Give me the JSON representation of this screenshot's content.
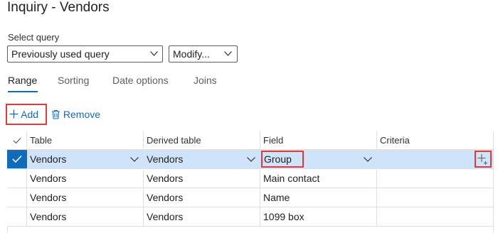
{
  "page": {
    "title": "Inquiry - Vendors"
  },
  "query": {
    "select_label": "Select query",
    "selected": "Previously used query",
    "modify_label": "Modify..."
  },
  "tabs": [
    {
      "label": "Range",
      "active": true
    },
    {
      "label": "Sorting",
      "active": false
    },
    {
      "label": "Date options",
      "active": false
    },
    {
      "label": "Joins",
      "active": false
    }
  ],
  "toolbar": {
    "add_label": "Add",
    "remove_label": "Remove"
  },
  "grid": {
    "headers": [
      "Table",
      "Derived table",
      "Field",
      "Criteria"
    ],
    "rows": [
      {
        "table": "Vendors",
        "derived": "Vendors",
        "field": "Group",
        "criteria": "",
        "selected": true
      },
      {
        "table": "Vendors",
        "derived": "Vendors",
        "field": "Main contact",
        "criteria": ""
      },
      {
        "table": "Vendors",
        "derived": "Vendors",
        "field": "Name",
        "criteria": ""
      },
      {
        "table": "Vendors",
        "derived": "Vendors",
        "field": "1099 box",
        "criteria": ""
      }
    ]
  },
  "colors": {
    "accent": "#0f6cbd",
    "selected_row": "#cfe4fa",
    "highlight": "#e03a3a"
  },
  "icons": {
    "add": "plus-icon",
    "remove": "trash-icon",
    "check": "checkmark-icon",
    "dropdown": "chevron-down-icon",
    "criteria": "add-criteria-icon"
  }
}
